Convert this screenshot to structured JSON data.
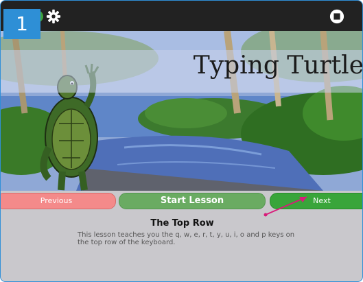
{
  "toolbar": {
    "step_number": "1",
    "settings_icon": "gear-icon",
    "stop_icon": "stop-icon",
    "activity_indicator_color": "#3ea33e"
  },
  "banner": {
    "title": "Typing Turtle"
  },
  "buttons": {
    "previous_label": "Previous",
    "start_label": "Start Lesson",
    "next_label": "Next"
  },
  "lesson": {
    "title": "The Top Row",
    "description": "This lesson teaches you the q, w, e, r, t, y, u, i, o and p keys on the top row of the keyboard."
  },
  "colors": {
    "accent_blue": "#2e8fd6",
    "previous_red": "#f48a8a",
    "start_green": "#6aab62",
    "next_green": "#39a53a",
    "background": "#c9c8cc"
  }
}
